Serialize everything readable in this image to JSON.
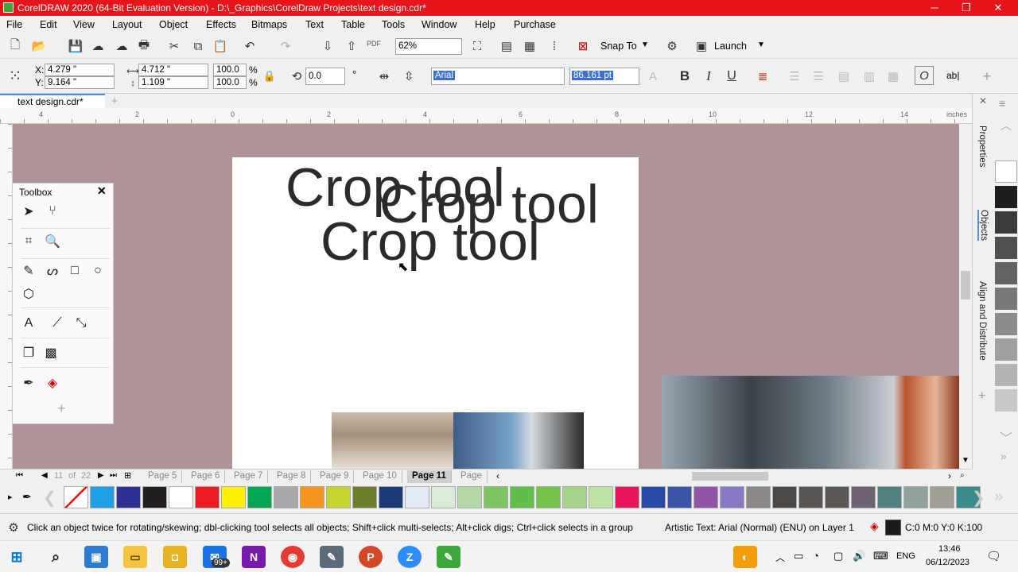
{
  "window": {
    "title": "CorelDRAW 2020 (64-Bit Evaluation Version) - D:\\_Graphics\\CorelDraw Projects\\text design.cdr*",
    "minimize": "─",
    "maximize": "❐",
    "close": "✕"
  },
  "menu": [
    "File",
    "Edit",
    "View",
    "Layout",
    "Object",
    "Effects",
    "Bitmaps",
    "Text",
    "Table",
    "Tools",
    "Window",
    "Help",
    "Purchase"
  ],
  "standard_toolbar": {
    "zoom": "62%",
    "snap_to": "Snap To",
    "launch": "Launch",
    "pdf": "PDF"
  },
  "property_bar": {
    "x_label": "X:",
    "y_label": "Y:",
    "x": "4.279 \"",
    "y": "9.164 \"",
    "width": "4.712 \"",
    "height": "1.109 \"",
    "scale_w": "100.0",
    "scale_h": "100.0",
    "pct": "%",
    "rotation": "0.0",
    "degree": "°",
    "font": "Arial",
    "font_size": "86.161 pt",
    "bold": "B",
    "italic": "I",
    "underline": "U",
    "text_edit": "ab|"
  },
  "document_tab": "text design.cdr*",
  "ruler": {
    "labels": [
      "4",
      "2",
      "0",
      "2",
      "4",
      "6",
      "8",
      "10",
      "12",
      "14"
    ],
    "unit": "inches"
  },
  "canvas": {
    "texts": [
      "Crop tool",
      "Crop tool",
      "Crop tool"
    ]
  },
  "toolbox": {
    "title": "Toolbox",
    "close": "✕",
    "add": "+"
  },
  "right_dock": {
    "tabs": [
      "Properties",
      "Objects",
      "Align and Distribute"
    ]
  },
  "page_nav": {
    "current": "11",
    "of": "of",
    "total": "22",
    "pages": [
      "Page 5",
      "Page 6",
      "Page 7",
      "Page 8",
      "Page 9",
      "Page 10",
      "Page 11",
      "Page"
    ]
  },
  "palette_colors": [
    "#ffffff",
    "#1ea1e8",
    "#2e3192",
    "#231f20",
    "#ffffff",
    "#ed1c24",
    "#fff200",
    "#00a651",
    "#a7a9ac",
    "#f7941d",
    "#c5d52f",
    "#6b7f2e",
    "#1b3a78",
    "#e4e9f6",
    "#d9ecd9",
    "#b3d9a8",
    "#7cc562",
    "#5fbf4a",
    "#76c34b",
    "#a6d38a",
    "#bde3a7",
    "#e8175d",
    "#2a4aa8",
    "#3a55a8",
    "#9254a6",
    "#8b78c4",
    "#8d8886",
    "#4b4846",
    "#595552",
    "#5c5654",
    "#6c6272",
    "#52807e",
    "#8fa39a",
    "#a09e95",
    "#3a8c8c"
  ],
  "right_palette": [
    "#ffffff",
    "#1e1e1e",
    "#3c3c3c",
    "#505050",
    "#646464",
    "#787878",
    "#8c8c8c",
    "#a0a0a0",
    "#b4b4b4",
    "#c8c8c8"
  ],
  "status": {
    "hint": "Click an object twice for rotating/skewing; dbl-clicking tool selects all objects; Shift+click multi-selects; Alt+click digs; Ctrl+click selects in a group",
    "object_info": "Artistic Text: Arial (Normal) (ENU) on Layer 1",
    "color": "C:0 M:0 Y:0 K:100"
  },
  "taskbar": {
    "lang": "ENG",
    "time": "13:46",
    "date": "06/12/2023",
    "mail_badge": "99+"
  }
}
